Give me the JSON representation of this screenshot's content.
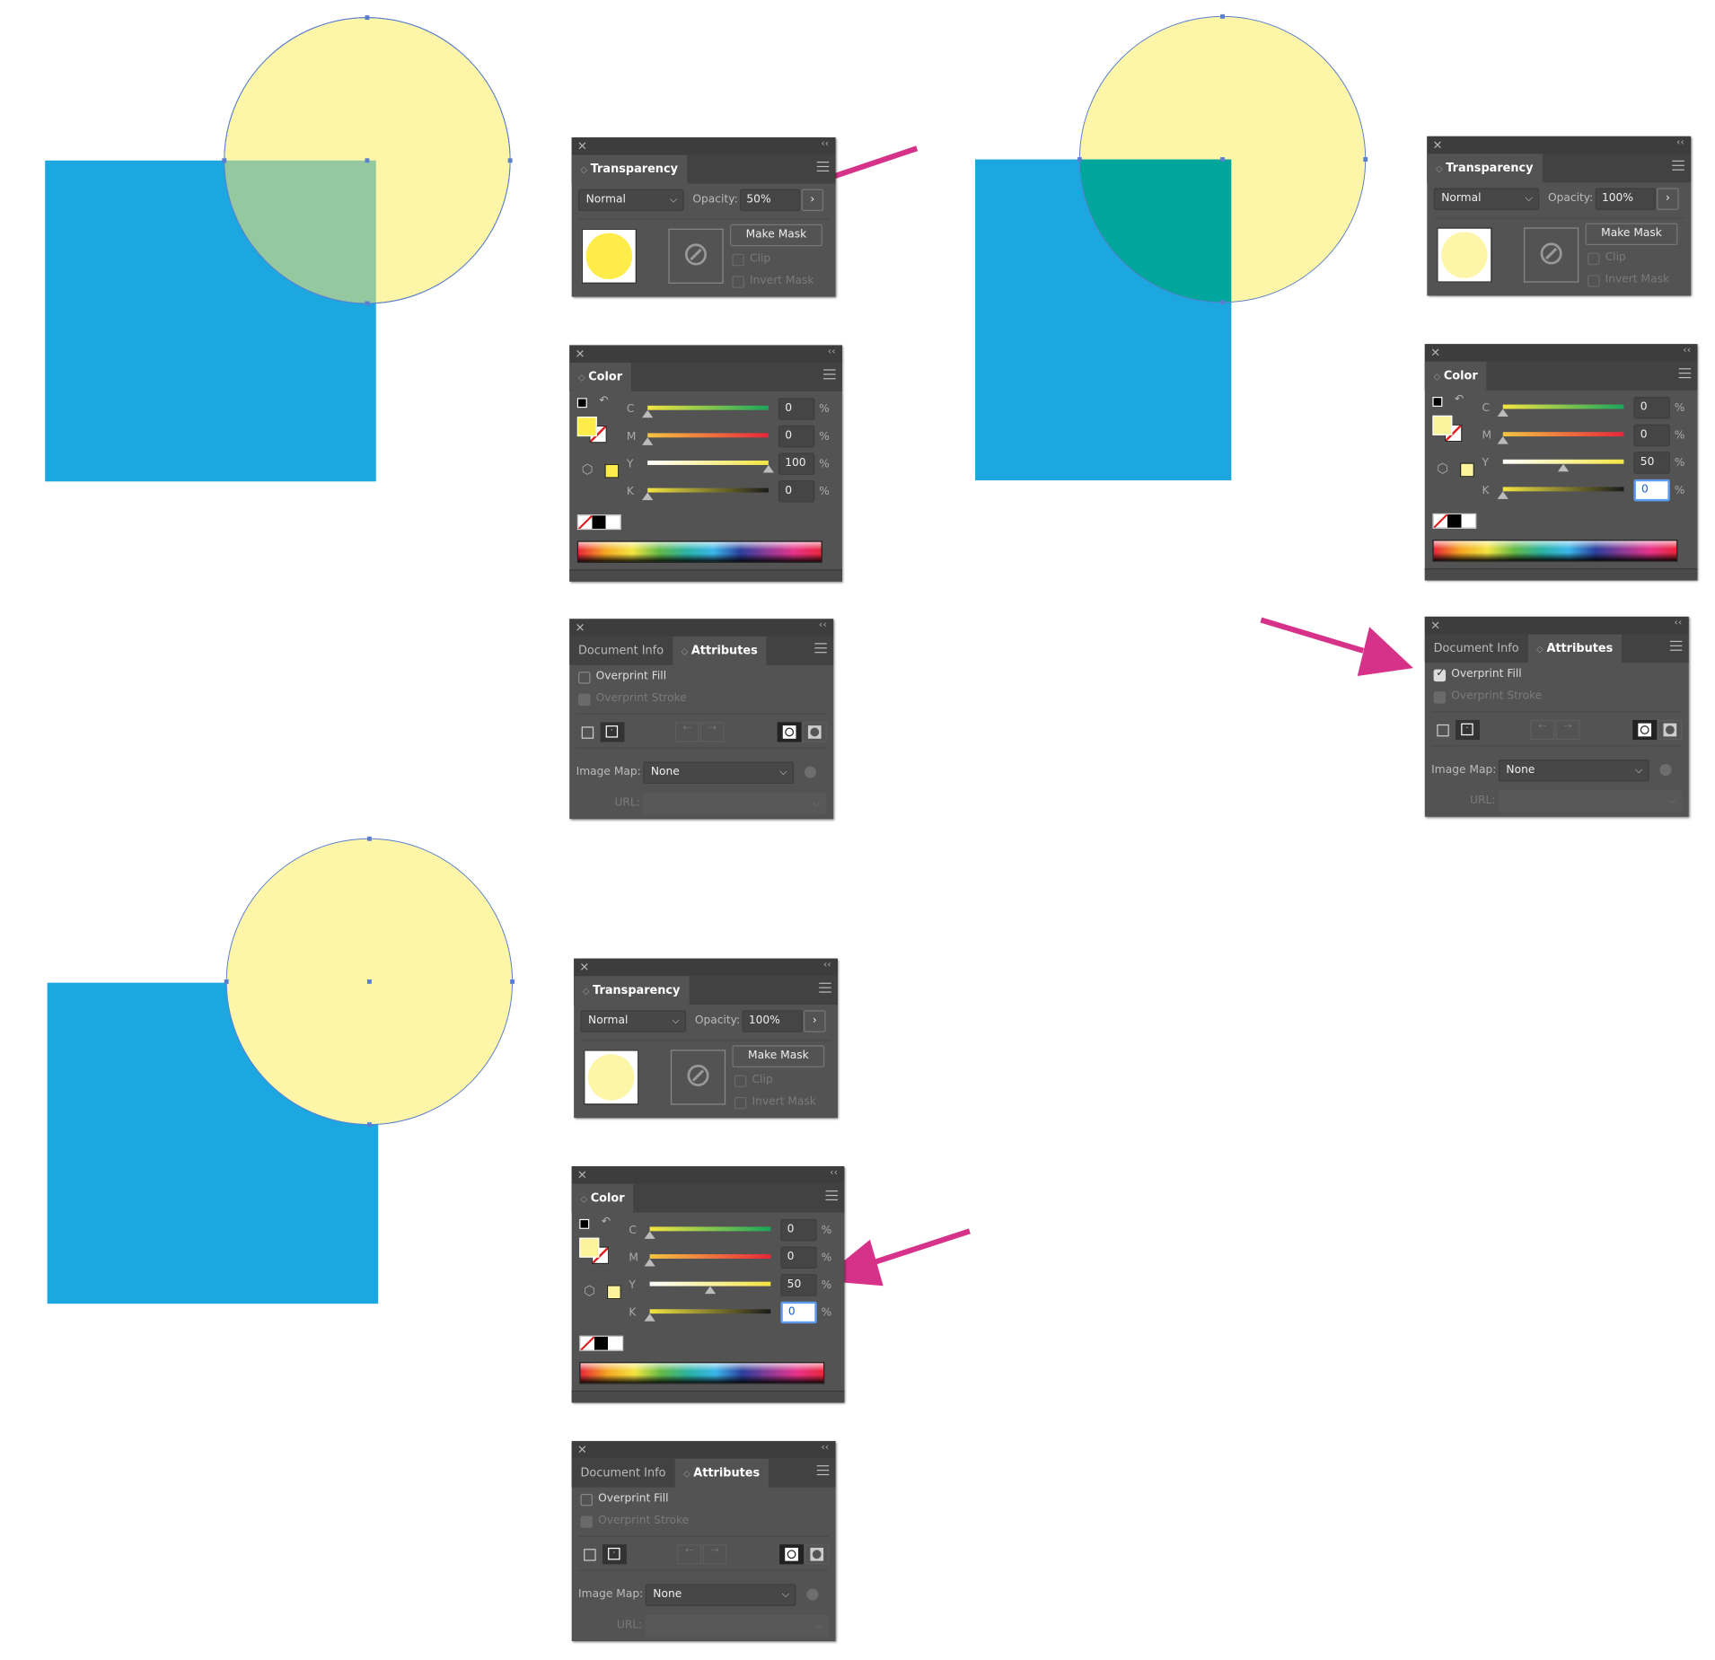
{
  "colors": {
    "square": "#1ca7e1",
    "circle": "#fdf6a8",
    "overlap_50": "#94c89e",
    "overlap_overprint": "#00a59c",
    "arrow": "#d6328a",
    "panel": "#535353"
  },
  "panels": [
    {
      "type": "transparency",
      "tab": "Transparency",
      "blend_mode": "Normal",
      "opacity_label": "Opacity:",
      "opacity": "50%",
      "make_mask": "Make Mask",
      "clip": "Clip",
      "invert_mask": "Invert Mask",
      "thumb_color": "#fdec4a"
    },
    {
      "type": "color",
      "tab": "Color",
      "c": "0",
      "m": "0",
      "y": "100",
      "k": "0",
      "pct": "%",
      "labels": [
        "C",
        "M",
        "Y",
        "K"
      ],
      "fill": "#fdec4a",
      "k_focused": false
    },
    {
      "type": "attributes",
      "tabs": [
        "Document Info",
        "Attributes"
      ],
      "overprint_fill": "Overprint Fill",
      "overprint_stroke": "Overprint Stroke",
      "overprint_fill_checked": false,
      "image_map_label": "Image Map:",
      "image_map": "None",
      "url_label": "URL:"
    },
    {
      "type": "transparency",
      "tab": "Transparency",
      "blend_mode": "Normal",
      "opacity_label": "Opacity:",
      "opacity": "100%",
      "make_mask": "Make Mask",
      "clip": "Clip",
      "invert_mask": "Invert Mask",
      "thumb_color": "#fdf6a8"
    },
    {
      "type": "color",
      "tab": "Color",
      "c": "0",
      "m": "0",
      "y": "50",
      "k": "0",
      "pct": "%",
      "labels": [
        "C",
        "M",
        "Y",
        "K"
      ],
      "fill": "#fdf39a",
      "k_focused": true
    },
    {
      "type": "attributes",
      "tabs": [
        "Document Info",
        "Attributes"
      ],
      "overprint_fill": "Overprint Fill",
      "overprint_stroke": "Overprint Stroke",
      "overprint_fill_checked": true,
      "image_map_label": "Image Map:",
      "image_map": "None",
      "url_label": "URL:"
    },
    {
      "type": "transparency",
      "tab": "Transparency",
      "blend_mode": "Normal",
      "opacity_label": "Opacity:",
      "opacity": "100%",
      "make_mask": "Make Mask",
      "clip": "Clip",
      "invert_mask": "Invert Mask",
      "thumb_color": "#fdf6a8"
    },
    {
      "type": "color",
      "tab": "Color",
      "c": "0",
      "m": "0",
      "y": "50",
      "k": "0",
      "pct": "%",
      "labels": [
        "C",
        "M",
        "Y",
        "K"
      ],
      "fill": "#fdf39a",
      "k_focused": true
    },
    {
      "type": "attributes",
      "tabs": [
        "Document Info",
        "Attributes"
      ],
      "overprint_fill": "Overprint Fill",
      "overprint_stroke": "Overprint Stroke",
      "overprint_fill_checked": false,
      "image_map_label": "Image Map:",
      "image_map": "None",
      "url_label": "URL:"
    }
  ]
}
